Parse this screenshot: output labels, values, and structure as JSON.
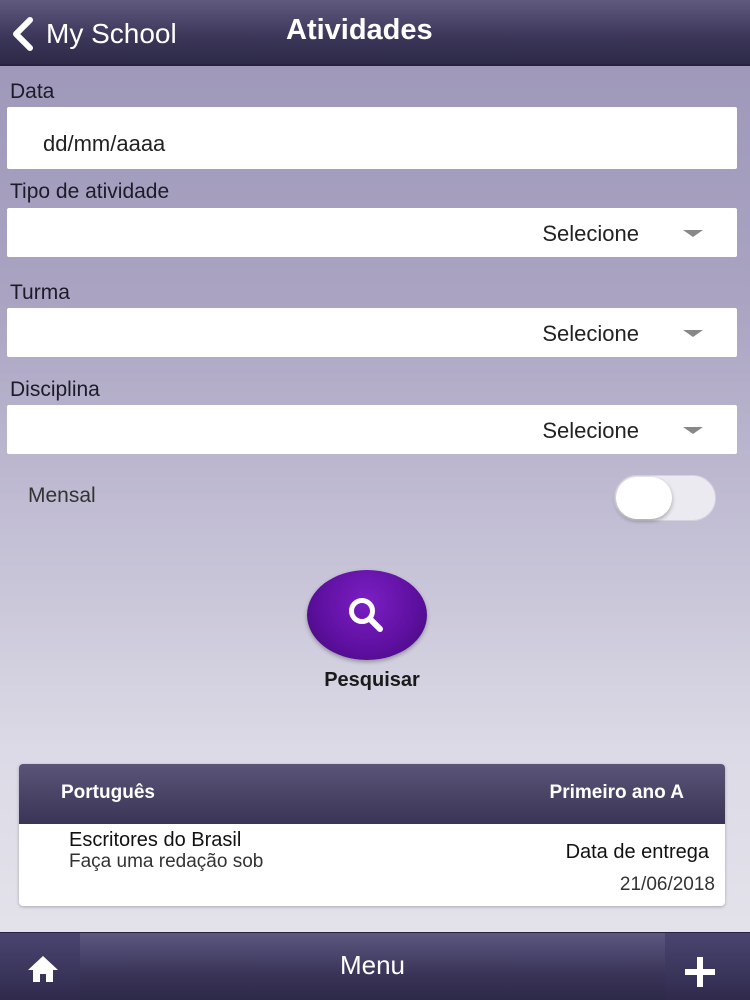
{
  "header": {
    "back_label": "My School",
    "title": "Atividades"
  },
  "form": {
    "date": {
      "label": "Data",
      "placeholder": "dd/mm/aaaa"
    },
    "activity_type": {
      "label": "Tipo de atividade",
      "value": "Selecione"
    },
    "class": {
      "label": "Turma",
      "value": "Selecione"
    },
    "discipline": {
      "label": "Disciplina",
      "value": "Selecione"
    },
    "monthly": {
      "label": "Mensal",
      "enabled": false
    }
  },
  "search": {
    "label": "Pesquisar"
  },
  "results": [
    {
      "subject": "Português",
      "class": "Primeiro ano A",
      "title": "Escritores do Brasil",
      "description": "Faça uma redação sob",
      "due_label": "Data de entrega",
      "due_date": "21/06/2018"
    }
  ],
  "footer": {
    "home_icon": "home-icon",
    "menu_label": "Menu",
    "add_icon": "plus-icon"
  },
  "colors": {
    "header_bg": "#3b3658",
    "accent_purple": "#5d0f9e"
  }
}
